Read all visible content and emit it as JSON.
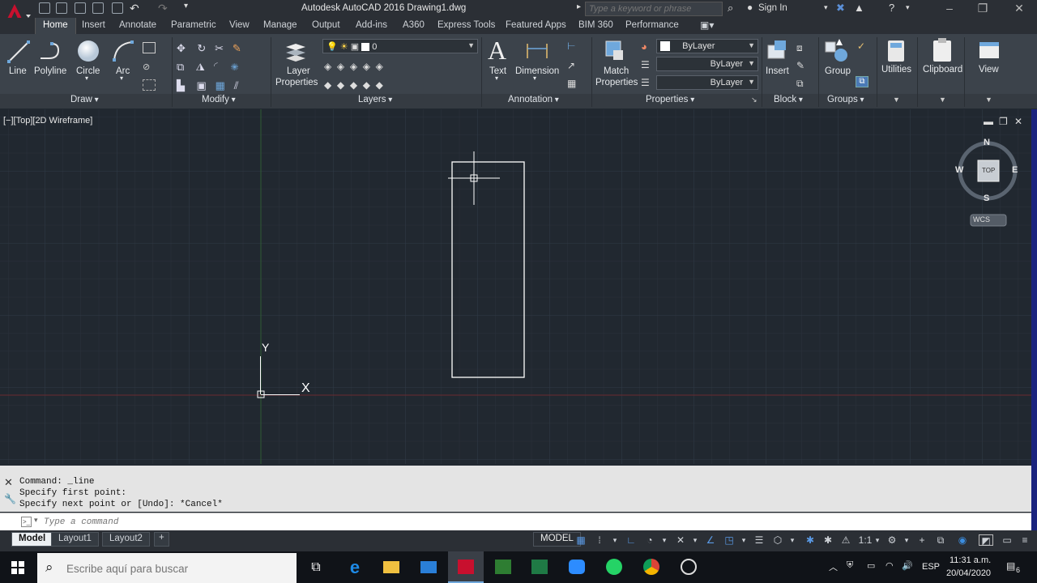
{
  "app": {
    "title": "Autodesk AutoCAD 2016   Drawing1.dwg",
    "search_placeholder": "Type a keyword or phrase",
    "sign_in": "Sign In"
  },
  "ribbon_tabs": [
    "Home",
    "Insert",
    "Annotate",
    "Parametric",
    "View",
    "Manage",
    "Output",
    "Add-ins",
    "A360",
    "Express Tools",
    "Featured Apps",
    "BIM 360",
    "Performance"
  ],
  "draw_tools": [
    "Line",
    "Polyline",
    "Circle",
    "Arc"
  ],
  "panels": {
    "draw": "Draw",
    "modify": "Modify",
    "layers": "Layers",
    "annotation": "Annotation",
    "properties": "Properties",
    "block": "Block",
    "groups": "Groups"
  },
  "layers": {
    "layer_properties_l1": "Layer",
    "layer_properties_l2": "Properties",
    "current_layer": "0"
  },
  "annotation": {
    "text": "Text",
    "dimension": "Dimension"
  },
  "properties": {
    "match_l1": "Match",
    "match_l2": "Properties",
    "color": "ByLayer",
    "linetype": "ByLayer",
    "lineweight": "ByLayer"
  },
  "block": {
    "insert": "Insert"
  },
  "groups": {
    "group": "Group"
  },
  "extra": {
    "utilities": "Utilities",
    "clipboard": "Clipboard",
    "view": "View"
  },
  "viewport": {
    "label": "[−][Top][2D Wireframe]",
    "ucs_x": "X",
    "ucs_y": "Y"
  },
  "viewcube": {
    "n": "N",
    "s": "S",
    "e": "E",
    "w": "W",
    "face": "TOP",
    "wcs": "WCS"
  },
  "command": {
    "history": [
      "Command: _line",
      "Specify first point:",
      "Specify next point or [Undo]: *Cancel*"
    ],
    "placeholder": "Type a command"
  },
  "layout_tabs": [
    "Model",
    "Layout1",
    "Layout2"
  ],
  "status": {
    "model": "MODEL",
    "scale": "1:1"
  },
  "taskbar": {
    "search_placeholder": "Escribe aquí para buscar",
    "lang": "ESP",
    "time": "11:31 a.m.",
    "date": "20/04/2020",
    "notifications": "6"
  },
  "colors": {
    "accent": "#1e6fd9",
    "crosshair_x": "#8a2a2a",
    "crosshair_y": "#2a6a2a"
  }
}
